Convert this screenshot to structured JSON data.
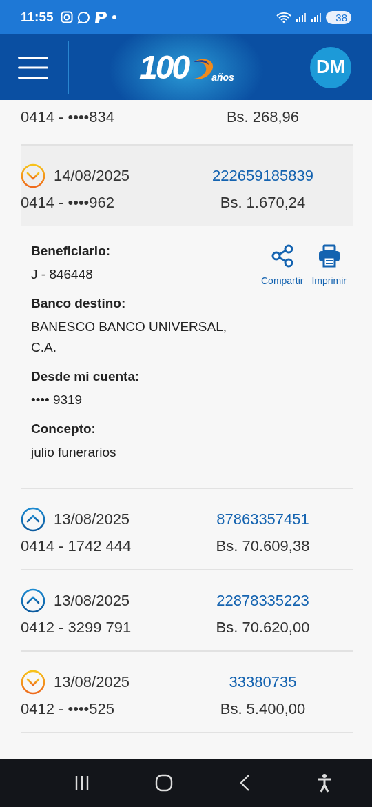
{
  "status_bar": {
    "time": "11:55",
    "battery": "38"
  },
  "header": {
    "logo_number": "100",
    "logo_suffix": "años",
    "avatar": "DM"
  },
  "transfers": [
    {
      "account": "0414 - ••••834",
      "amount": "Bs. 268,96",
      "expanded": false
    },
    {
      "kind": "out",
      "date": "14/08/2025",
      "reference": "222659185839",
      "account": "0414 - ••••962",
      "amount": "Bs. 1.670,24",
      "expanded": true,
      "details": [
        {
          "label": "Beneficiario:",
          "value": "J - 846448"
        },
        {
          "label": "Banco destino:",
          "value": "BANESCO BANCO UNIVERSAL, C.A."
        },
        {
          "label": "Desde mi cuenta:",
          "value": "••••  9319"
        },
        {
          "label": "Concepto:",
          "value": "julio funerarios"
        }
      ],
      "actions": [
        {
          "kind": "share",
          "label": "Compartir"
        },
        {
          "kind": "print",
          "label": "Imprimir"
        }
      ]
    },
    {
      "kind": "in",
      "date": "13/08/2025",
      "reference": "87863357451",
      "account": "0414 - 1742 444",
      "amount": "Bs. 70.609,38",
      "expanded": false
    },
    {
      "kind": "in",
      "date": "13/08/2025",
      "reference": "22878335223",
      "account": "0412 - 3299 791",
      "amount": "Bs. 70.620,00",
      "expanded": false
    },
    {
      "kind": "out",
      "date": "13/08/2025",
      "reference": "33380735",
      "account": "0412 - ••••525",
      "amount": "Bs. 5.400,00",
      "expanded": false
    }
  ]
}
